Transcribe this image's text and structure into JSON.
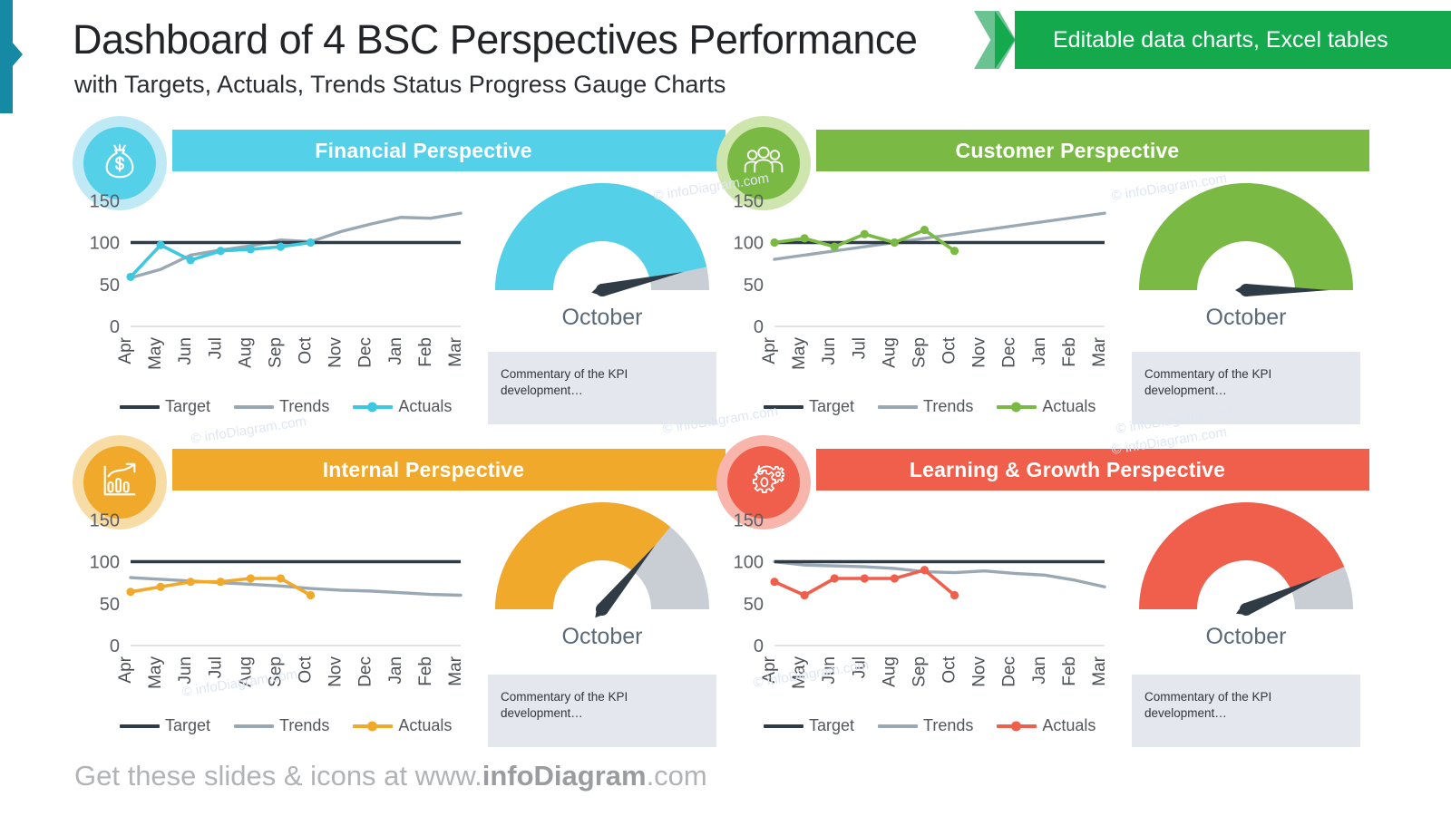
{
  "header": {
    "title": "Dashboard of 4 BSC Perspectives Performance",
    "subtitle": "with Targets, Actuals, Trends Status Progress Gauge Charts",
    "ribbon_label": "Editable data charts, Excel tables",
    "ribbon_color": "#15a94e"
  },
  "footer": {
    "prefix": "Get these slides & icons at www.",
    "brand": "infoDiagram",
    "suffix": ".com"
  },
  "watermark": "© infoDiagram.com",
  "legend": {
    "target": "Target",
    "trends": "Trends",
    "actuals": "Actuals",
    "target_color": "#2f3b45",
    "trends_color": "#9aa8b4"
  },
  "commentary_text": "Commentary of the KPI development…",
  "gauge_month": "October",
  "panels": [
    {
      "id": "financial",
      "title": "Financial Perspective",
      "color": "#54d1e8",
      "ring_color": "#bfeaf5",
      "icon": "money-bag-icon",
      "gauge_percent": 93,
      "needle_percent": 93,
      "commentary": "Commentary of the KPI development…",
      "gauge_month": "October"
    },
    {
      "id": "customer",
      "title": "Customer Perspective",
      "color": "#7ab943",
      "ring_color": "#cfe5ae",
      "icon": "people-group-icon",
      "gauge_percent": 100,
      "needle_percent": 100,
      "commentary": "Commentary of the KPI development…",
      "gauge_month": "October"
    },
    {
      "id": "internal",
      "title": "Internal Perspective",
      "color": "#f0a92b",
      "ring_color": "#f8dca6",
      "icon": "bar-chart-growth-icon",
      "gauge_percent": 72,
      "needle_percent": 72,
      "commentary": "Commentary of the KPI development…",
      "gauge_month": "October"
    },
    {
      "id": "learning",
      "title": "Learning & Growth Perspective",
      "color": "#ef5f4c",
      "ring_color": "#f8b5ab",
      "icon": "gears-refresh-icon",
      "gauge_percent": 87,
      "needle_percent": 87,
      "commentary": "Commentary of the KPI development…",
      "gauge_month": "October"
    }
  ],
  "chart_data": [
    {
      "type": "line",
      "title": "Financial Perspective",
      "categories": [
        "Apr",
        "May",
        "Jun",
        "Jul",
        "Aug",
        "Sep",
        "Oct",
        "Nov",
        "Dec",
        "Jan",
        "Feb",
        "Mar"
      ],
      "ylim": [
        0,
        160
      ],
      "yticks": [
        0,
        50,
        100,
        150
      ],
      "xlabel": "",
      "ylabel": "",
      "grid": false,
      "legend_position": "bottom",
      "series": [
        {
          "name": "Target",
          "color": "#2f3b45",
          "values": [
            100,
            100,
            100,
            100,
            100,
            100,
            100,
            100,
            100,
            100,
            100,
            100
          ]
        },
        {
          "name": "Trends",
          "color": "#9aa8b4",
          "values": [
            58,
            68,
            85,
            91,
            96,
            103,
            101,
            113,
            122,
            130,
            129,
            135
          ]
        },
        {
          "name": "Actuals",
          "color": "#3ec8e0",
          "values": [
            59,
            97,
            79,
            90,
            92,
            95,
            100,
            null,
            null,
            null,
            null,
            null
          ]
        }
      ]
    },
    {
      "type": "line",
      "title": "Customer Perspective",
      "categories": [
        "Apr",
        "May",
        "Jun",
        "Jul",
        "Aug",
        "Sep",
        "Oct",
        "Nov",
        "Dec",
        "Jan",
        "Feb",
        "Mar"
      ],
      "ylim": [
        0,
        160
      ],
      "yticks": [
        0,
        50,
        100,
        150
      ],
      "xlabel": "",
      "ylabel": "",
      "grid": false,
      "legend_position": "bottom",
      "series": [
        {
          "name": "Target",
          "color": "#2f3b45",
          "values": [
            100,
            100,
            100,
            100,
            100,
            100,
            100,
            100,
            100,
            100,
            100,
            100
          ]
        },
        {
          "name": "Trends",
          "color": "#9aa8b4",
          "values": [
            80,
            85,
            90,
            95,
            100,
            105,
            110,
            115,
            120,
            125,
            130,
            135
          ]
        },
        {
          "name": "Actuals",
          "color": "#7ab943",
          "values": [
            100,
            105,
            95,
            110,
            100,
            115,
            90,
            null,
            null,
            null,
            null,
            null
          ]
        }
      ]
    },
    {
      "type": "line",
      "title": "Internal Perspective",
      "categories": [
        "Apr",
        "May",
        "Jun",
        "Jul",
        "Aug",
        "Sep",
        "Oct",
        "Nov",
        "Dec",
        "Jan",
        "Feb",
        "Mar"
      ],
      "ylim": [
        0,
        160
      ],
      "yticks": [
        0,
        50,
        100,
        150
      ],
      "xlabel": "",
      "ylabel": "",
      "grid": false,
      "legend_position": "bottom",
      "series": [
        {
          "name": "Target",
          "color": "#2f3b45",
          "values": [
            100,
            100,
            100,
            100,
            100,
            100,
            100,
            100,
            100,
            100,
            100,
            100
          ]
        },
        {
          "name": "Trends",
          "color": "#9aa8b4",
          "values": [
            81,
            79,
            77,
            75,
            73,
            71,
            68,
            66,
            65,
            63,
            61,
            60
          ]
        },
        {
          "name": "Actuals",
          "color": "#f0a92b",
          "values": [
            64,
            70,
            76,
            76,
            80,
            80,
            60,
            null,
            null,
            null,
            null,
            null
          ]
        }
      ]
    },
    {
      "type": "line",
      "title": "Learning & Growth Perspective",
      "categories": [
        "Apr",
        "May",
        "Jun",
        "Jul",
        "Aug",
        "Sep",
        "Oct",
        "Nov",
        "Dec",
        "Jan",
        "Feb",
        "Mar"
      ],
      "ylim": [
        0,
        160
      ],
      "yticks": [
        0,
        50,
        100,
        150
      ],
      "xlabel": "",
      "ylabel": "",
      "grid": false,
      "legend_position": "bottom",
      "series": [
        {
          "name": "Target",
          "color": "#2f3b45",
          "values": [
            100,
            100,
            100,
            100,
            100,
            100,
            100,
            100,
            100,
            100,
            100,
            100
          ]
        },
        {
          "name": "Trends",
          "color": "#9aa8b4",
          "values": [
            100,
            96,
            95,
            94,
            92,
            88,
            87,
            89,
            86,
            84,
            78,
            70
          ]
        },
        {
          "name": "Actuals",
          "color": "#ef5f4c",
          "values": [
            76,
            60,
            80,
            80,
            80,
            90,
            60,
            null,
            null,
            null,
            null,
            null
          ]
        }
      ]
    }
  ]
}
